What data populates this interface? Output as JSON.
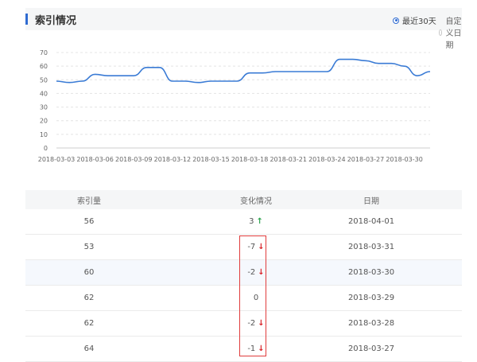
{
  "header": {
    "title": "索引情况",
    "radio_recent": "最近30天",
    "radio_custom": "自定义日期"
  },
  "chart_data": {
    "type": "line",
    "x": [
      "2018-03-03",
      "2018-03-04",
      "2018-03-05",
      "2018-03-06",
      "2018-03-07",
      "2018-03-08",
      "2018-03-09",
      "2018-03-10",
      "2018-03-11",
      "2018-03-12",
      "2018-03-13",
      "2018-03-14",
      "2018-03-15",
      "2018-03-16",
      "2018-03-17",
      "2018-03-18",
      "2018-03-19",
      "2018-03-20",
      "2018-03-21",
      "2018-03-22",
      "2018-03-23",
      "2018-03-24",
      "2018-03-25",
      "2018-03-26",
      "2018-03-27",
      "2018-03-28",
      "2018-03-29",
      "2018-03-30",
      "2018-03-31",
      "2018-04-01"
    ],
    "values": [
      49,
      48,
      49,
      54,
      53,
      53,
      53,
      59,
      59,
      49,
      49,
      48,
      49,
      49,
      49,
      55,
      55,
      56,
      56,
      56,
      56,
      56,
      65,
      65,
      64,
      62,
      62,
      60,
      53,
      56
    ],
    "xticks": [
      "2018-03-03",
      "2018-03-06",
      "2018-03-09",
      "2018-03-12",
      "2018-03-15",
      "2018-03-18",
      "2018-03-21",
      "2018-03-24",
      "2018-03-27",
      "2018-03-30"
    ],
    "yticks": [
      0,
      10,
      20,
      30,
      40,
      50,
      60,
      70
    ],
    "ylim": [
      0,
      70
    ],
    "grid": true,
    "color": "#3a7bd5"
  },
  "table": {
    "headers": [
      "索引量",
      "变化情况",
      "日期"
    ],
    "rows": [
      {
        "count": "56",
        "change": "3",
        "trend": "up",
        "date": "2018-04-01"
      },
      {
        "count": "53",
        "change": "-7",
        "trend": "down",
        "date": "2018-03-31"
      },
      {
        "count": "60",
        "change": "-2",
        "trend": "down",
        "date": "2018-03-30"
      },
      {
        "count": "62",
        "change": "0",
        "trend": "none",
        "date": "2018-03-29"
      },
      {
        "count": "62",
        "change": "-2",
        "trend": "down",
        "date": "2018-03-28"
      },
      {
        "count": "64",
        "change": "-1",
        "trend": "down",
        "date": "2018-03-27"
      }
    ]
  }
}
